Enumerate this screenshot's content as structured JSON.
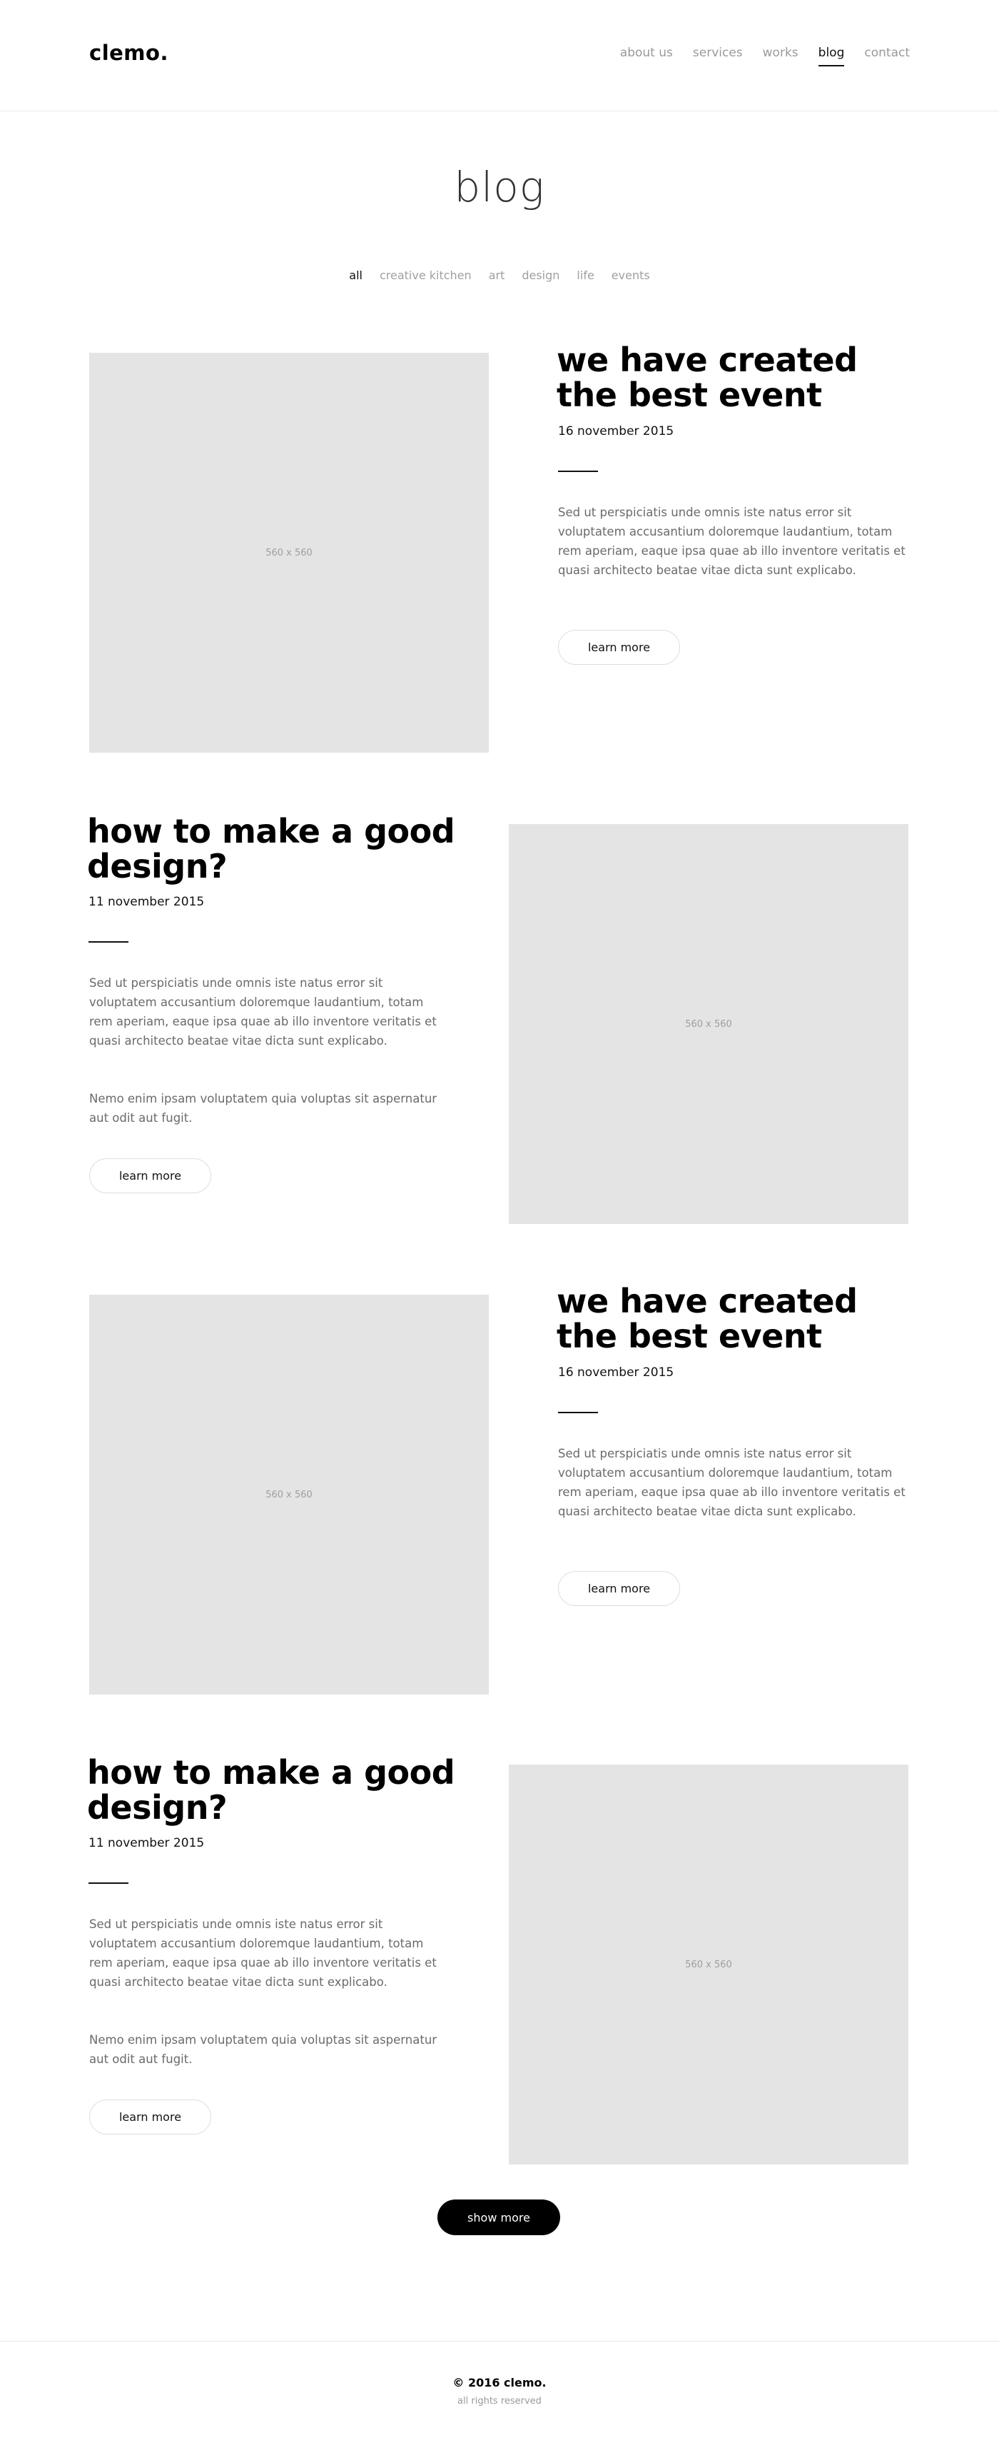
{
  "header": {
    "logo": "clemo.",
    "nav": [
      {
        "label": "about us",
        "active": false
      },
      {
        "label": "services",
        "active": false
      },
      {
        "label": "works",
        "active": false
      },
      {
        "label": "blog",
        "active": true
      },
      {
        "label": "contact",
        "active": false
      }
    ]
  },
  "page": {
    "title": "blog",
    "filters": [
      {
        "label": "all",
        "active": true
      },
      {
        "label": "creative kitchen",
        "active": false
      },
      {
        "label": "art",
        "active": false
      },
      {
        "label": "design",
        "active": false
      },
      {
        "label": "life",
        "active": false
      },
      {
        "label": "events",
        "active": false
      }
    ]
  },
  "posts": [
    {
      "title_line1": "we have created",
      "title_line2": "the best event",
      "date": "16 november 2015",
      "text1": "Sed ut perspiciatis unde omnis iste natus error sit voluptatem accusantium doloremque laudantium, totam rem aperiam, eaque ipsa quae ab illo inventore veritatis et quasi architecto beatae vitae dicta sunt explicabo.",
      "text2": "",
      "image_label": "560 x 560",
      "button": "learn more"
    },
    {
      "title_line1": "how to make a good",
      "title_line2": "design?",
      "date": "11 november 2015",
      "text1": "Sed ut perspiciatis unde omnis iste natus error sit voluptatem accusantium doloremque laudantium, totam rem aperiam, eaque ipsa quae ab illo inventore veritatis et quasi architecto beatae vitae dicta sunt explicabo.",
      "text2": "Nemo enim ipsam voluptatem quia voluptas sit aspernatur aut odit aut fugit.",
      "image_label": "560 x 560",
      "button": "learn more"
    },
    {
      "title_line1": "we have created",
      "title_line2": "the best event",
      "date": "16 november 2015",
      "text1": "Sed ut perspiciatis unde omnis iste natus error sit voluptatem accusantium doloremque laudantium, totam rem aperiam, eaque ipsa quae ab illo inventore veritatis et quasi architecto beatae vitae dicta sunt explicabo.",
      "text2": "",
      "image_label": "560 x 560",
      "button": "learn more"
    },
    {
      "title_line1": "how to make a good",
      "title_line2": "design?",
      "date": "11 november 2015",
      "text1": "Sed ut perspiciatis unde omnis iste natus error sit voluptatem accusantium doloremque laudantium, totam rem aperiam, eaque ipsa quae ab illo inventore veritatis et quasi architecto beatae vitae dicta sunt explicabo.",
      "text2": "Nemo enim ipsam voluptatem quia voluptas sit aspernatur aut odit aut fugit.",
      "image_label": "560 x 560",
      "button": "learn more"
    }
  ],
  "show_more": "show more",
  "footer": {
    "copyright": "© 2016 clemo.",
    "rights": "all rights reserved"
  }
}
